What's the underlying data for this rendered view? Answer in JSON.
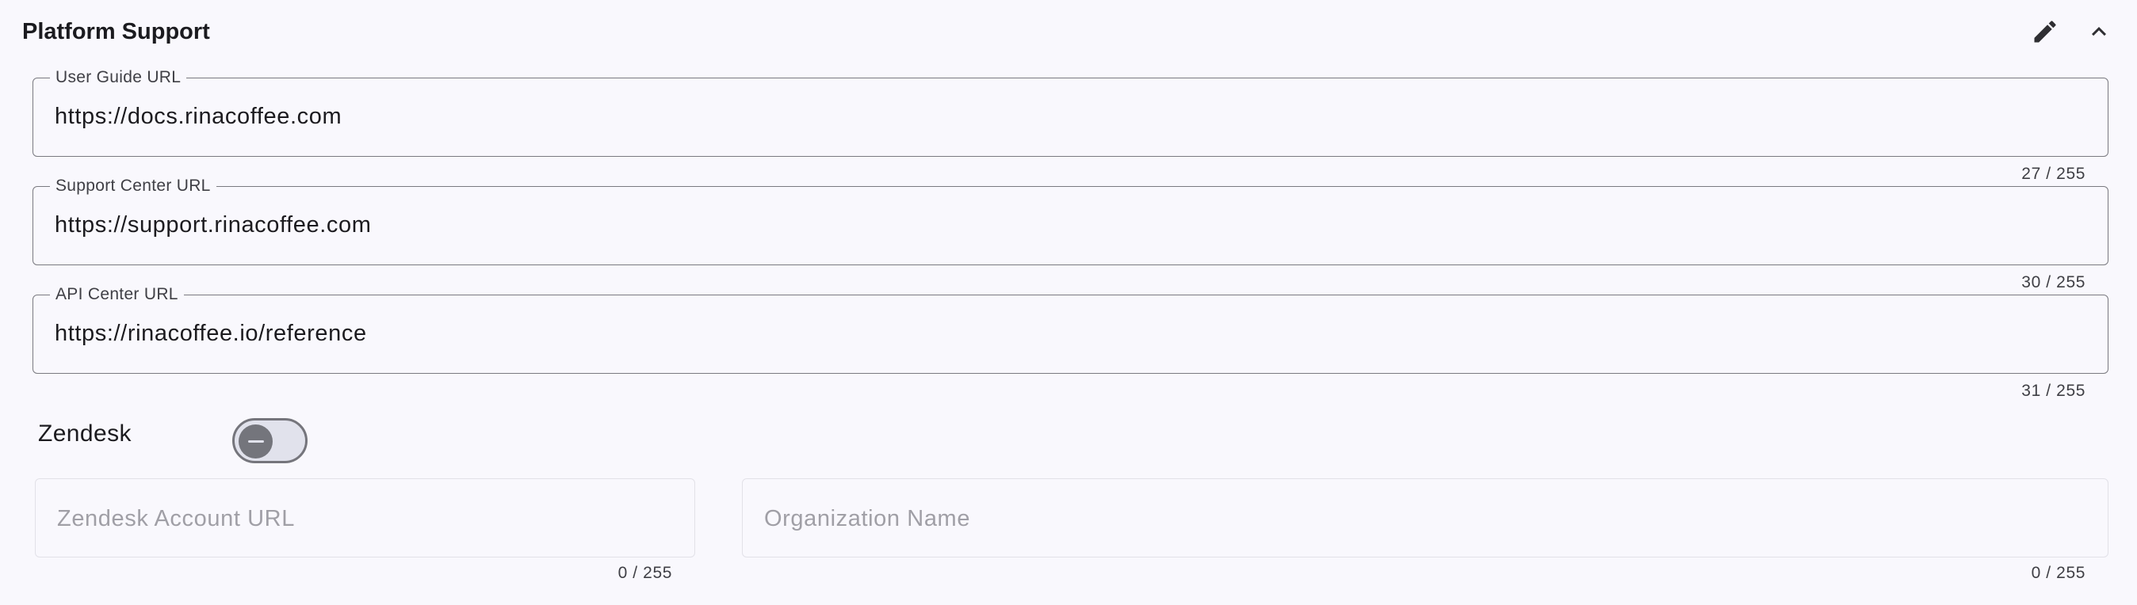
{
  "header": {
    "title": "Platform Support",
    "edit_icon": "pencil-icon",
    "collapse_icon": "chevron-up-icon"
  },
  "fields": {
    "user_guide": {
      "label": "User Guide URL",
      "value": "https://docs.rinacoffee.com",
      "counter": "27 / 255"
    },
    "support_center": {
      "label": "Support Center URL",
      "value": "https://support.rinacoffee.com",
      "counter": "30 / 255"
    },
    "api_center": {
      "label": "API Center URL",
      "value": "https://rinacoffee.io/reference",
      "counter": "31 / 255"
    }
  },
  "zendesk": {
    "label": "Zendesk",
    "toggle_state": "off",
    "account_url": {
      "placeholder": "Zendesk Account URL",
      "counter": "0 / 255"
    },
    "organization_name": {
      "placeholder": "Organization Name",
      "counter": "0 / 255"
    }
  },
  "colors": {
    "background": "#f9f8fd",
    "outline": "#7a7a80",
    "disabled_outline": "#e2e1e8",
    "toggle_track": "#e1e2ec",
    "toggle_thumb": "#74757c"
  }
}
